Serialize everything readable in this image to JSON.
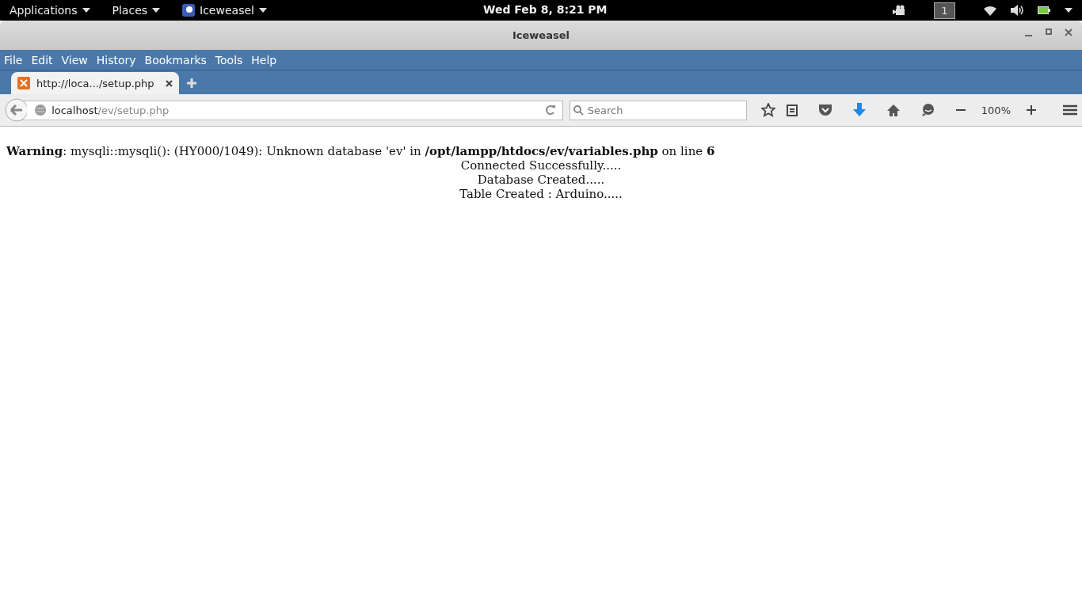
{
  "top_bar": {
    "menus": [
      {
        "label": "Applications",
        "kind": "plain"
      },
      {
        "label": "Places",
        "kind": "plain"
      },
      {
        "label": "Iceweasel",
        "kind": "app"
      }
    ],
    "clock": "Wed Feb  8,  8:21 PM",
    "workspace": "1"
  },
  "window": {
    "title": "Iceweasel"
  },
  "menu_bar": [
    "File",
    "Edit",
    "View",
    "History",
    "Bookmarks",
    "Tools",
    "Help"
  ],
  "tabs": [
    {
      "label": "http://loca.../setup.php",
      "selected": true
    }
  ],
  "address_bar": {
    "host": "localhost",
    "path": "/ev/setup.php"
  },
  "search": {
    "placeholder": "Search"
  },
  "zoom": "100%",
  "page": {
    "warning": "**Warning**: mysqli::mysqli(): (HY000/1049): Unknown database 'ev' in **/opt/lampp/htdocs/ev/variables.php** on line **6**",
    "lines": [
      "Connected Successfully.....",
      "Database Created.....",
      "Table Created : Arduino....."
    ]
  }
}
